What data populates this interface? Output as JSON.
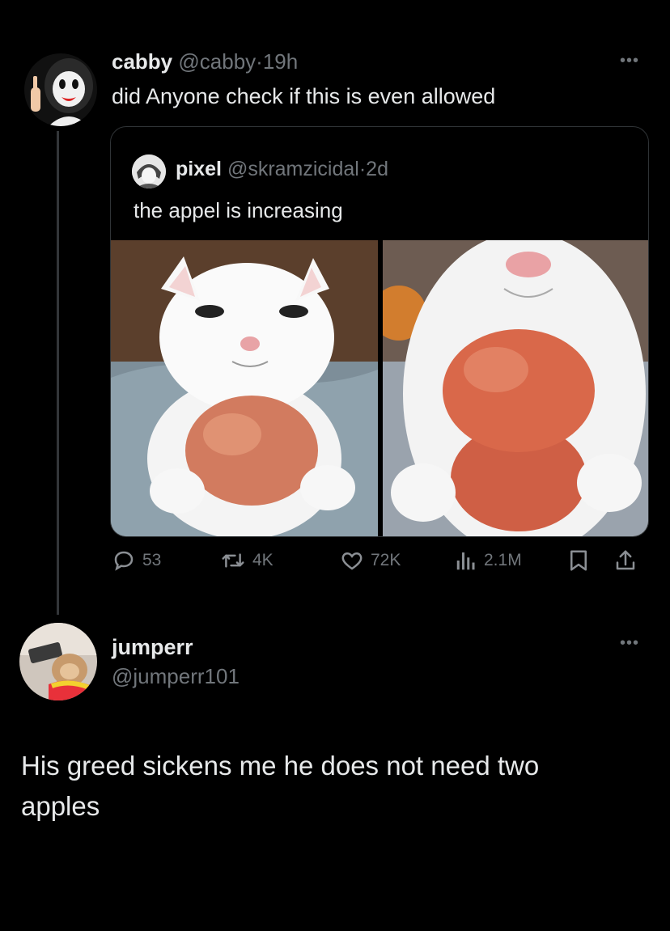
{
  "reply_tweet": {
    "display_name": "cabby",
    "handle": "@cabby",
    "separator": "·",
    "time": "19h",
    "text": "did Anyone check if this is even allowed",
    "more_icon": "more-horizontal-icon"
  },
  "quoted_tweet": {
    "display_name": "pixel",
    "handle": "@skramzicidal",
    "separator": "·",
    "time": "2d",
    "text": "the appel is increasing",
    "images": [
      "white-cat-with-one-apple",
      "white-cat-with-two-apples"
    ]
  },
  "actions": {
    "replies": "53",
    "reposts": "4K",
    "likes": "72K",
    "views": "2.1M",
    "icons": [
      "reply-icon",
      "repost-icon",
      "like-icon",
      "views-icon",
      "bookmark-icon",
      "share-icon"
    ]
  },
  "next_tweet": {
    "display_name": "jumperr",
    "handle": "@jumperr101",
    "text": "His greed sickens me he does not need two apples",
    "more_icon": "more-horizontal-icon"
  },
  "colors": {
    "background": "#000000",
    "text_primary": "#e7e9ea",
    "text_secondary": "#71767b",
    "border": "#2f3336",
    "thread_line": "#333639"
  }
}
